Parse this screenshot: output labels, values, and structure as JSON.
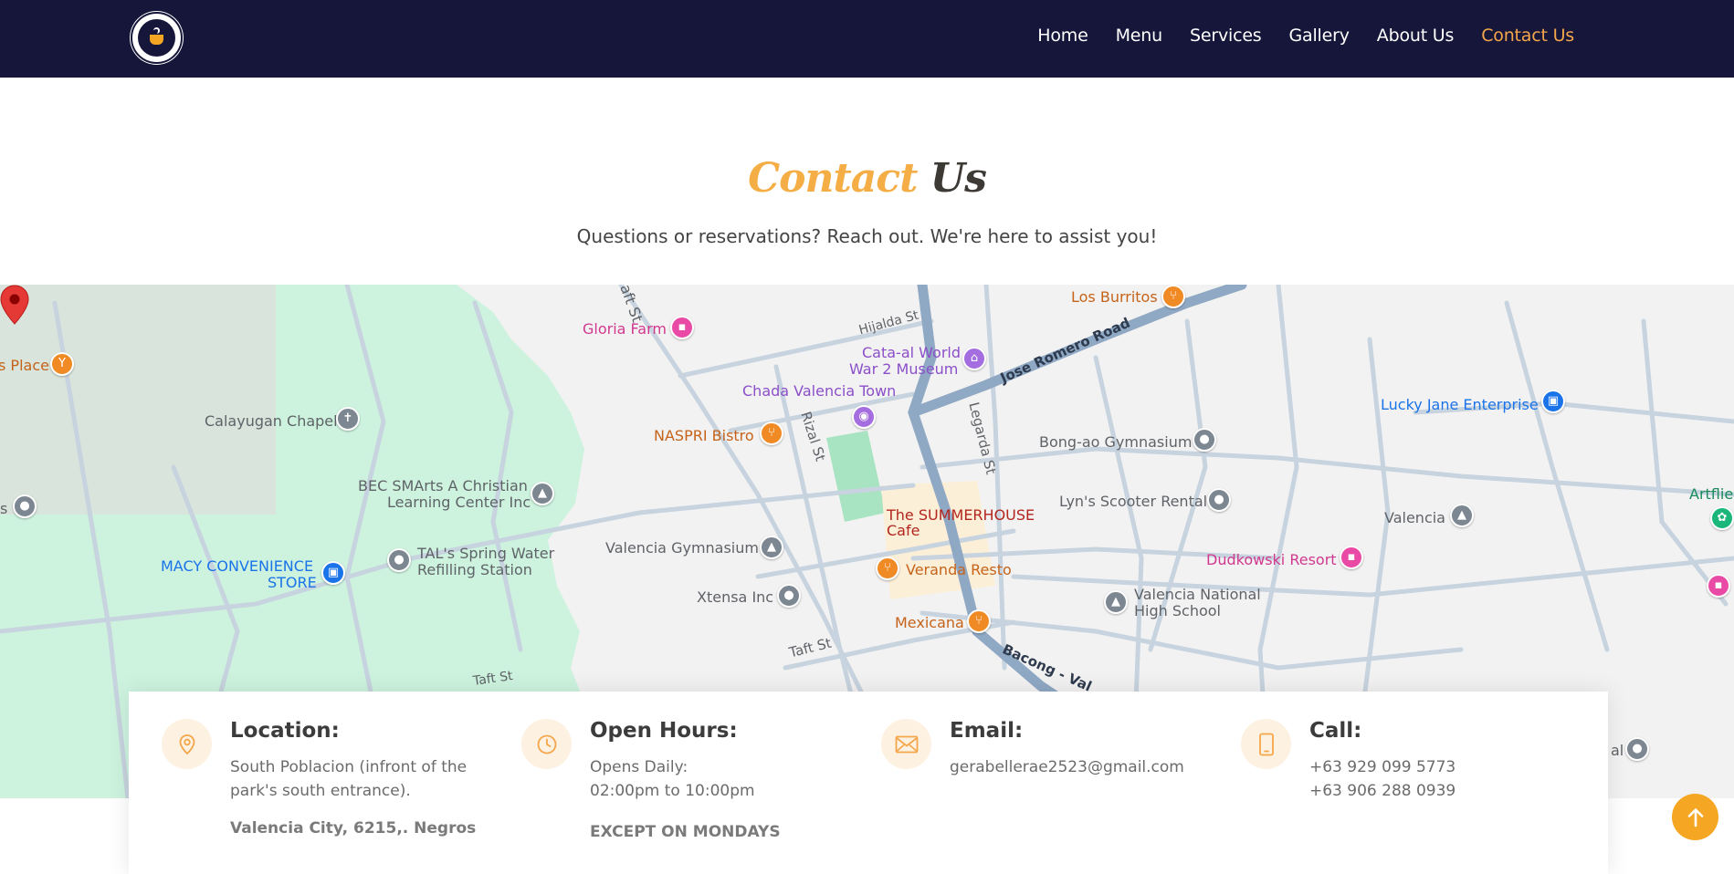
{
  "header": {
    "logo_alt": "The Tiny Summerhouse Cafe",
    "nav": [
      {
        "label": "Home"
      },
      {
        "label": "Menu"
      },
      {
        "label": "Services"
      },
      {
        "label": "Gallery"
      },
      {
        "label": "About Us"
      },
      {
        "label": "Contact Us",
        "active": true
      }
    ]
  },
  "section": {
    "title_part1": "Contact",
    "title_part2": "Us",
    "subtitle": "Questions or reservations? Reach out. We're here to assist you!"
  },
  "map": {
    "places": {
      "gloria_farm": "Gloria Farm",
      "los_burritos": "Los Burritos",
      "hijalda_st": "Hijalda St",
      "jose_romero_road": "Jose Romero Road",
      "cata_al_line1": "Cata-al World",
      "cata_al_line2": "War 2 Museum",
      "chada": "Chada Valencia Town",
      "lucky_jane": "Lucky Jane Enterprise",
      "calayugan": "Calayugan Chapel",
      "place_partial": "s Place",
      "naspri": "NASPRI Bistro",
      "rizal_st": "Rizal St",
      "legarda_st": "Legarda St",
      "bong_ao": "Bong-ao Gymnasium",
      "bec_line1": "BEC SMArts A Christian",
      "bec_line2": "Learning Center Inc",
      "lyns": "Lyn's Scooter Rental",
      "summerhouse_line1": "The SUMMERHOUSE",
      "summerhouse_line2": "Cafe",
      "valencia": "Valencia",
      "artflie": "Artflie",
      "s_partial": "s",
      "valencia_gym": "Valencia Gymnasium",
      "tals_line1": "TAL's Spring Water",
      "tals_line2": "Refilling Station",
      "macy_line1": "MACY CONVENIENCE",
      "macy_line2": "STORE",
      "dudkowski": "Dudkowski Resort",
      "veranda": "Veranda Resto",
      "xtensa": "Xtensa Inc",
      "vnhs_line1": "Valencia National",
      "vnhs_line2": "High School",
      "mexicana": "Mexicana",
      "taft_st": "Taft St",
      "taft_st2": "Taft St",
      "taft_top": "aft St",
      "bacong": "Bacong - Val",
      "al_partial": "al"
    }
  },
  "contact": {
    "location": {
      "icon": "map-pin-icon",
      "title": "Location:",
      "text": "South Poblacion (infront of the park's south entrance).",
      "strong": "Valencia City, 6215,. Negros"
    },
    "hours": {
      "icon": "clock-icon",
      "title": "Open Hours:",
      "line1": "Opens Daily:",
      "line2": "02:00pm to 10:00pm",
      "strong": "EXCEPT ON MONDAYS"
    },
    "email": {
      "icon": "envelope-icon",
      "title": "Email:",
      "text": "gerabellerae2523@gmail.com"
    },
    "call": {
      "icon": "phone-icon",
      "title": "Call:",
      "phone1": "+63 929 099 5773",
      "phone2": "+63 906 288 0939"
    }
  },
  "colors": {
    "header_bg": "#16163a",
    "accent": "#f5a623",
    "active_nav": "#f5a64a"
  }
}
